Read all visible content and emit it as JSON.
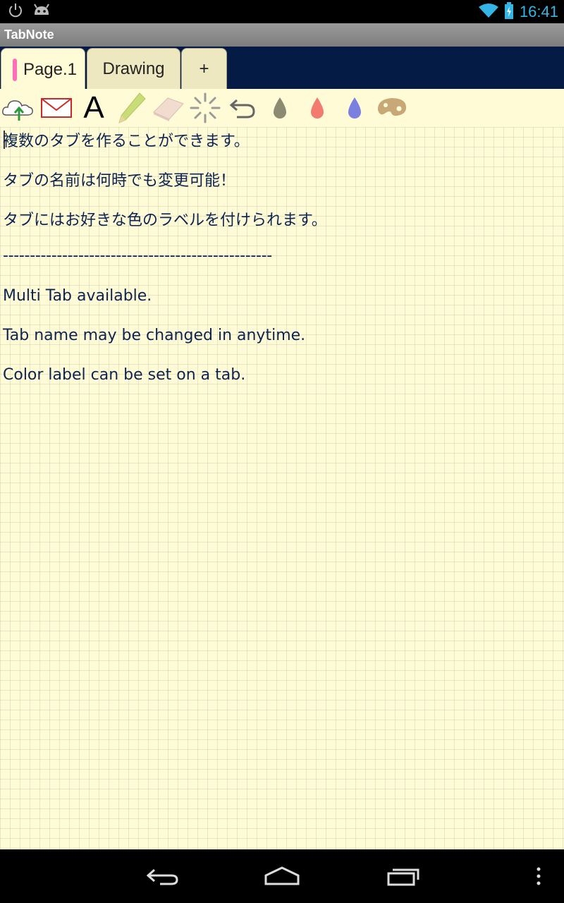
{
  "status_bar": {
    "time": "16:41",
    "icons": [
      "power-icon",
      "android-debug-icon",
      "wifi-icon",
      "battery-icon"
    ]
  },
  "app": {
    "title": "TabNote"
  },
  "tabs": [
    {
      "label": "Page.1",
      "active": true,
      "color_label": "#ff6fb7"
    },
    {
      "label": "Drawing",
      "active": false
    },
    {
      "label": "+",
      "active": false
    }
  ],
  "toolbar": {
    "tools": [
      "cloud-upload-icon",
      "mail-icon",
      "text-icon",
      "pencil-icon",
      "eraser-icon",
      "brush-size-icon",
      "undo-icon",
      "ink-gray-icon",
      "ink-red-icon",
      "ink-blue-icon",
      "palette-icon"
    ],
    "text_tool_glyph": "A",
    "ink_colors": [
      "#8c8a70",
      "#f27a6e",
      "#7b7fe0"
    ]
  },
  "note": {
    "lines": [
      "複数のタブを作ることができます。",
      "タブの名前は何時でも変更可能！",
      "タブにはお好きな色のラベルを付けられます。",
      "--------------------------------------------------",
      "Multi Tab available.",
      "Tab name may be changed in anytime.",
      "Color label can be set on a tab."
    ]
  },
  "nav_bar": {
    "buttons": [
      "back-icon",
      "home-icon",
      "recents-icon",
      "menu-icon"
    ]
  }
}
